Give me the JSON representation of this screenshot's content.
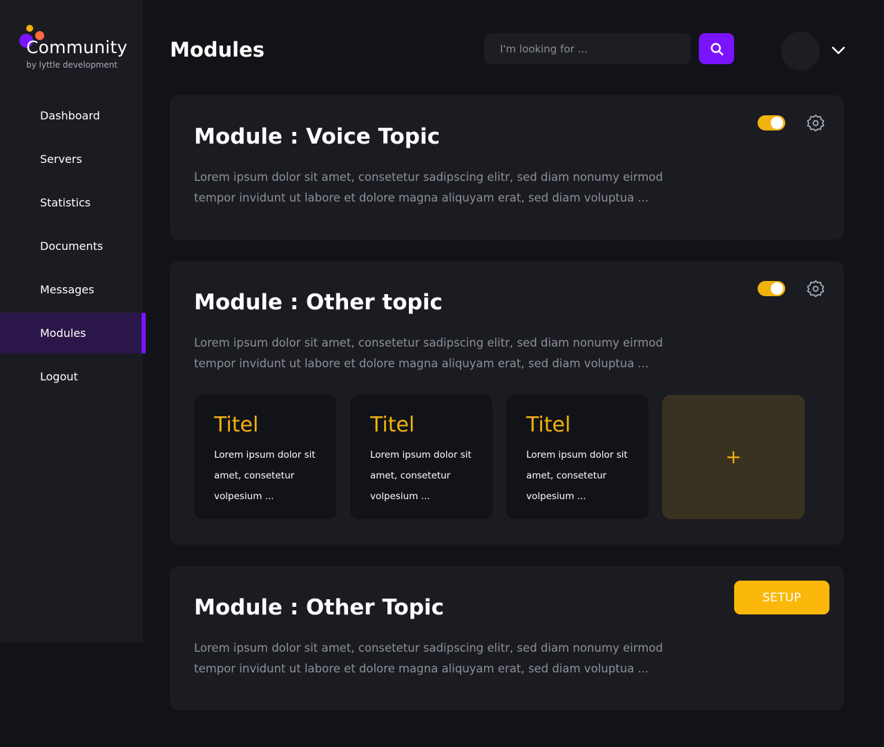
{
  "brand": {
    "name": "Community",
    "tagline": "by lyttle development",
    "colors": {
      "purple": "#7a14ff",
      "yellow": "#f2b20d",
      "orange": "#ff6a3d"
    }
  },
  "sidebar": {
    "items": [
      {
        "label": "Dashboard",
        "active": false
      },
      {
        "label": "Servers",
        "active": false
      },
      {
        "label": "Statistics",
        "active": false
      },
      {
        "label": "Documents",
        "active": false
      },
      {
        "label": "Messages",
        "active": false
      },
      {
        "label": "Modules",
        "active": true
      },
      {
        "label": "Logout",
        "active": false
      }
    ]
  },
  "header": {
    "title": "Modules",
    "search": {
      "placeholder": "I'm looking for ...",
      "value": "",
      "icon": "search-icon"
    },
    "user_menu_icon": "chevron-down-icon"
  },
  "modules": [
    {
      "title": "Module : Voice Topic",
      "description": "Lorem ipsum dolor sit amet, consetetur sadipscing elitr, sed diam nonumy eirmod tempor invidunt ut labore et dolore magna aliquyam erat, sed diam voluptua ...",
      "enabled": true,
      "settings_icon": "gear-icon"
    },
    {
      "title": "Module : Other topic",
      "description": "Lorem ipsum dolor sit amet, consetetur sadipscing elitr, sed diam nonumy eirmod tempor invidunt ut labore et dolore magna aliquyam erat, sed diam voluptua ...",
      "enabled": true,
      "settings_icon": "gear-icon",
      "items": [
        {
          "title": "Titel",
          "text": "Lorem ipsum dolor sit amet, consetetur volpesium ..."
        },
        {
          "title": "Titel",
          "text": "Lorem ipsum dolor sit amet, consetetur volpesium ..."
        },
        {
          "title": "Titel",
          "text": "Lorem ipsum dolor sit amet, consetetur volpesium ..."
        }
      ],
      "add_label": "+"
    },
    {
      "title": "Module : Other Topic",
      "description": "Lorem ipsum dolor sit amet, consetetur sadipscing elitr, sed diam nonumy eirmod tempor invidunt ut labore et dolore magna aliquyam erat, sed diam voluptua ...",
      "setup_label": "SETUP"
    }
  ]
}
